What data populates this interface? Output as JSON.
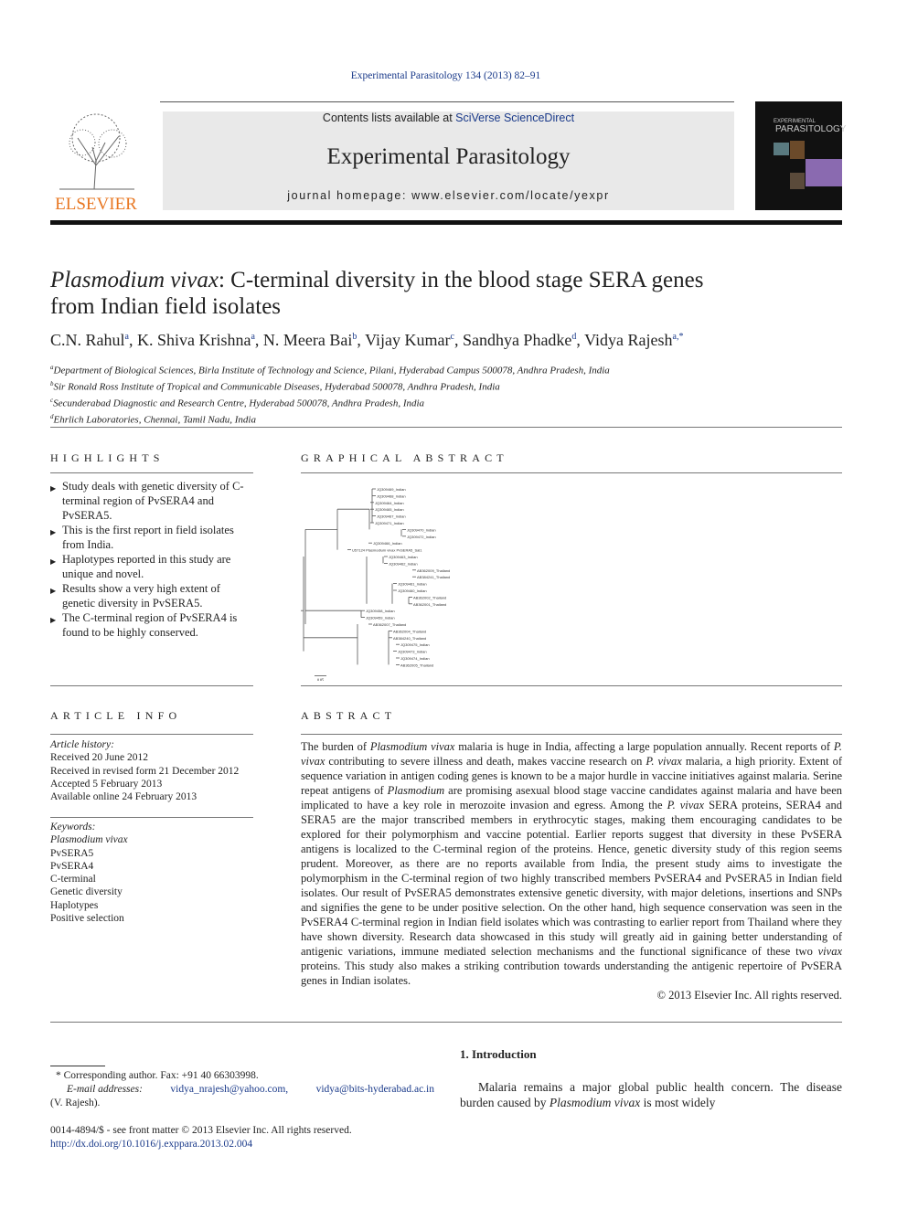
{
  "journal_citation": "Experimental Parasitology 134 (2013) 82–91",
  "header": {
    "contents_prefix": "Contents lists available at ",
    "contents_link": "SciVerse ScienceDirect",
    "journal_name": "Experimental Parasitology",
    "homepage": "journal homepage: www.elsevier.com/locate/yexpr",
    "publisher_logo": "ELSEVIER",
    "cover_title_1": "EXPERIMENTAL",
    "cover_title_2": "PARASITOLOGY"
  },
  "article": {
    "title_italic": "Plasmodium vivax",
    "title_rest": ": C-terminal diversity in the blood stage SERA genes",
    "title_line2": "from Indian field isolates",
    "authors": [
      {
        "name": "C.N. Rahul",
        "sup": "a"
      },
      {
        "name": "K. Shiva Krishna",
        "sup": "a"
      },
      {
        "name": "N. Meera Bai",
        "sup": "b"
      },
      {
        "name": "Vijay Kumar",
        "sup": "c"
      },
      {
        "name": "Sandhya Phadke",
        "sup": "d"
      },
      {
        "name": "Vidya Rajesh",
        "sup": "a,*"
      }
    ],
    "affiliations": [
      {
        "sup": "a",
        "text": "Department of Biological Sciences, Birla Institute of Technology and Science, Pilani, Hyderabad Campus 500078, Andhra Pradesh, India"
      },
      {
        "sup": "b",
        "text": "Sir Ronald Ross Institute of Tropical and Communicable Diseases, Hyderabad 500078, Andhra Pradesh, India"
      },
      {
        "sup": "c",
        "text": "Secunderabad Diagnostic and Research Centre, Hyderabad 500078, Andhra Pradesh, India"
      },
      {
        "sup": "d",
        "text": "Ehrlich Laboratories, Chennai, Tamil Nadu, India"
      }
    ]
  },
  "highlights": {
    "heading": "HIGHLIGHTS",
    "items": [
      "Study deals with genetic diversity of C-terminal region of PvSERA4 and PvSERA5.",
      "This is the first report in field isolates from India.",
      "Haplotypes reported in this study are unique and novel.",
      "Results show a very high extent of genetic diversity in PvSERA5.",
      "The C-terminal region of PvSERA4 is found to be highly conserved."
    ]
  },
  "graphical_abstract": {
    "heading": "GRAPHICAL ABSTRACT",
    "tree_labels": [
      "JQ309469_Indian",
      "JQ309468_Indian",
      "JQ309464_Indian",
      "JQ309465_Indian",
      "JQ309467_Indian",
      "JQ309471_Indian",
      "JQ309470_Indian",
      "JQ309472_Indian",
      "JQ309466_Indian",
      "U57124 Plasmodium vivax PvSERA5_Sal1",
      "JQ309463_Indian",
      "JQ309462_Indian",
      "AB362009_Thailand",
      "AB384241_Thailand",
      "JQ309461_Indian",
      "JQ309460_Indian",
      "AB362002_Thailand",
      "AB362001_Thailand",
      "JQ309458_Indian",
      "JQ309459_Indian",
      "AB362007_Thailand",
      "AB362004_Thailand",
      "AB384240_Thailand",
      "JQ309475_Indian",
      "JQ309473_Indian",
      "JQ309474_Indian",
      "AB362005_Thailand"
    ],
    "scale_label": "0.05"
  },
  "article_info": {
    "heading": "ARTICLE INFO",
    "history_label": "Article history:",
    "history": [
      "Received 20 June 2012",
      "Received in revised form 21 December 2012",
      "Accepted 5 February 2013",
      "Available online 24 February 2013"
    ],
    "keywords_label": "Keywords:",
    "keywords": [
      "Plasmodium vivax",
      "PvSERA5",
      "PvSERA4",
      "C-terminal",
      "Genetic diversity",
      "Haplotypes",
      "Positive selection"
    ]
  },
  "abstract": {
    "heading": "ABSTRACT",
    "text": "The burden of Plasmodium vivax malaria is huge in India, affecting a large population annually. Recent reports of P. vivax contributing to severe illness and death, makes vaccine research on P. vivax malaria, a high priority. Extent of sequence variation in antigen coding genes is known to be a major hurdle in vaccine initiatives against malaria. Serine repeat antigens of Plasmodium are promising asexual blood stage vaccine candidates against malaria and have been implicated to have a key role in merozoite invasion and egress. Among the P. vivax SERA proteins, SERA4 and SERA5 are the major transcribed members in erythrocytic stages, making them encouraging candidates to be explored for their polymorphism and vaccine potential. Earlier reports suggest that diversity in these PvSERA antigens is localized to the C-terminal region of the proteins. Hence, genetic diversity study of this region seems prudent. Moreover, as there are no reports available from India, the present study aims to investigate the polymorphism in the C-terminal region of two highly transcribed members PvSERA4 and PvSERA5 in Indian field isolates. Our result of PvSERA5 demonstrates extensive genetic diversity, with major deletions, insertions and SNPs and signifies the gene to be under positive selection. On the other hand, high sequence conservation was seen in the PvSERA4 C-terminal region in Indian field isolates which was contrasting to earlier report from Thailand where they have shown diversity. Research data showcased in this study will greatly aid in gaining better understanding of antigenic variations, immune mediated selection mechanisms and the functional significance of these two vivax proteins. This study also makes a striking contribution towards understanding the antigenic repertoire of PvSERA genes in Indian isolates.",
    "copyright": "© 2013 Elsevier Inc. All rights reserved."
  },
  "introduction": {
    "heading": "1. Introduction",
    "text": "Malaria remains a major global public health concern. The disease burden caused by Plasmodium vivax is most widely"
  },
  "footnotes": {
    "corresponding": "* Corresponding author. Fax: +91 40 66303998.",
    "email_label": "E-mail addresses:",
    "email1": "vidya_nrajesh@yahoo.com,",
    "email2": "vidya@bits-hyderabad.ac.in",
    "email_owner": "(V. Rajesh).",
    "front_matter": "0014-4894/$ - see front matter © 2013 Elsevier Inc. All rights reserved.",
    "doi": "http://dx.doi.org/10.1016/j.exppara.2013.02.004"
  }
}
